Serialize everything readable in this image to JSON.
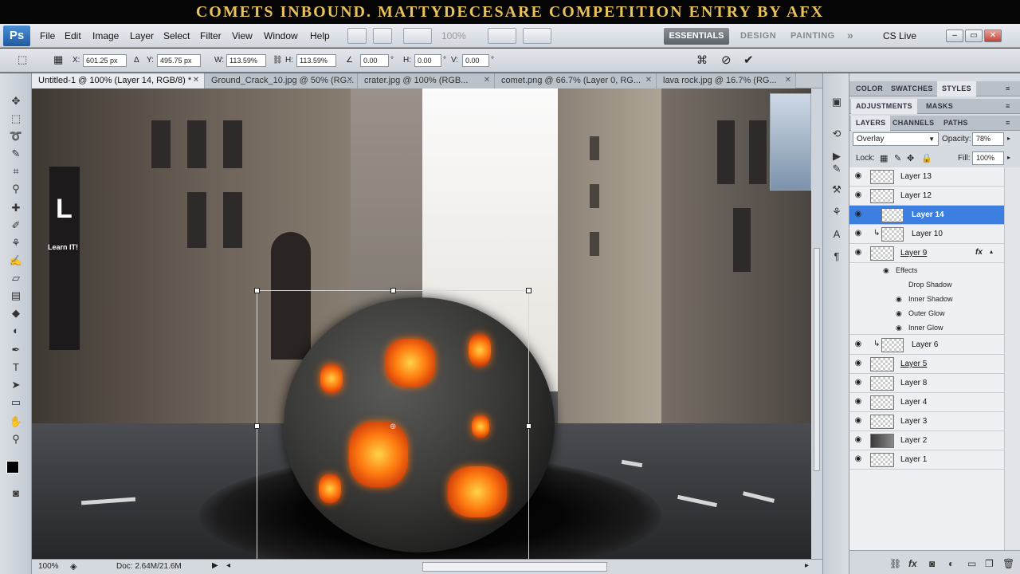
{
  "banner": {
    "text": "COMETS INBOUND. MATTYDECESARE COMPETITION ENTRY BY AFX"
  },
  "menubar": {
    "logo": "Ps",
    "items": [
      "File",
      "Edit",
      "Image",
      "Layer",
      "Select",
      "Filter",
      "View",
      "Window",
      "Help"
    ],
    "zoom": "100%",
    "workspaces": [
      "ESSENTIALS",
      "DESIGN",
      "PAINTING"
    ],
    "more": "»",
    "cs_live": "CS Live"
  },
  "optbar": {
    "x_label": "X:",
    "x_value": "601.25 px",
    "y_label": "Y:",
    "y_value": "495.75 px",
    "w_label": "W:",
    "w_value": "113.59%",
    "h_label": "H:",
    "h_value": "113.59%",
    "angle_value": "0.00",
    "deg": "°",
    "hskew_label": "H:",
    "hskew_value": "0.00",
    "vskew_label": "V:",
    "vskew_value": "0.00"
  },
  "tabs": [
    {
      "label": "Untitled-1 @ 100% (Layer 14, RGB/8) *",
      "active": true
    },
    {
      "label": "Ground_Crack_10.jpg @ 50% (RG..."
    },
    {
      "label": "crater.jpg @ 100% (RGB..."
    },
    {
      "label": "comet.png @ 66.7% (Layer 0, RG..."
    },
    {
      "label": "lava rock.jpg @ 16.7% (RG..."
    }
  ],
  "status": {
    "zoom": "100%",
    "doc": "Doc: 2.64M/21.6M"
  },
  "panels": {
    "top_tabs": [
      "COLOR",
      "SWATCHES",
      "STYLES"
    ],
    "mid_tabs": [
      "ADJUSTMENTS",
      "MASKS"
    ],
    "layer_tabs": [
      "LAYERS",
      "CHANNELS",
      "PATHS"
    ],
    "blend_mode": "Overlay",
    "opacity_label": "Opacity:",
    "opacity_value": "78%",
    "lock_label": "Lock:",
    "fill_label": "Fill:",
    "fill_value": "100%"
  },
  "layers": [
    {
      "name": "Layer 13"
    },
    {
      "name": "Layer 12"
    },
    {
      "name": "Layer 14",
      "selected": true
    },
    {
      "name": "Layer 10"
    },
    {
      "name": "Layer 9",
      "fx": "fx"
    },
    {
      "name": "Layer 6"
    },
    {
      "name": "Layer 5"
    },
    {
      "name": "Layer 8"
    },
    {
      "name": "Layer 4"
    },
    {
      "name": "Layer 3"
    },
    {
      "name": "Layer 2"
    },
    {
      "name": "Layer 1"
    }
  ],
  "effects": {
    "header": "Effects",
    "items": [
      "Drop Shadow",
      "Inner Shadow",
      "Outer Glow",
      "Inner Glow"
    ]
  },
  "canvas_sign": {
    "letter": "L",
    "sub": "Learn IT!"
  }
}
